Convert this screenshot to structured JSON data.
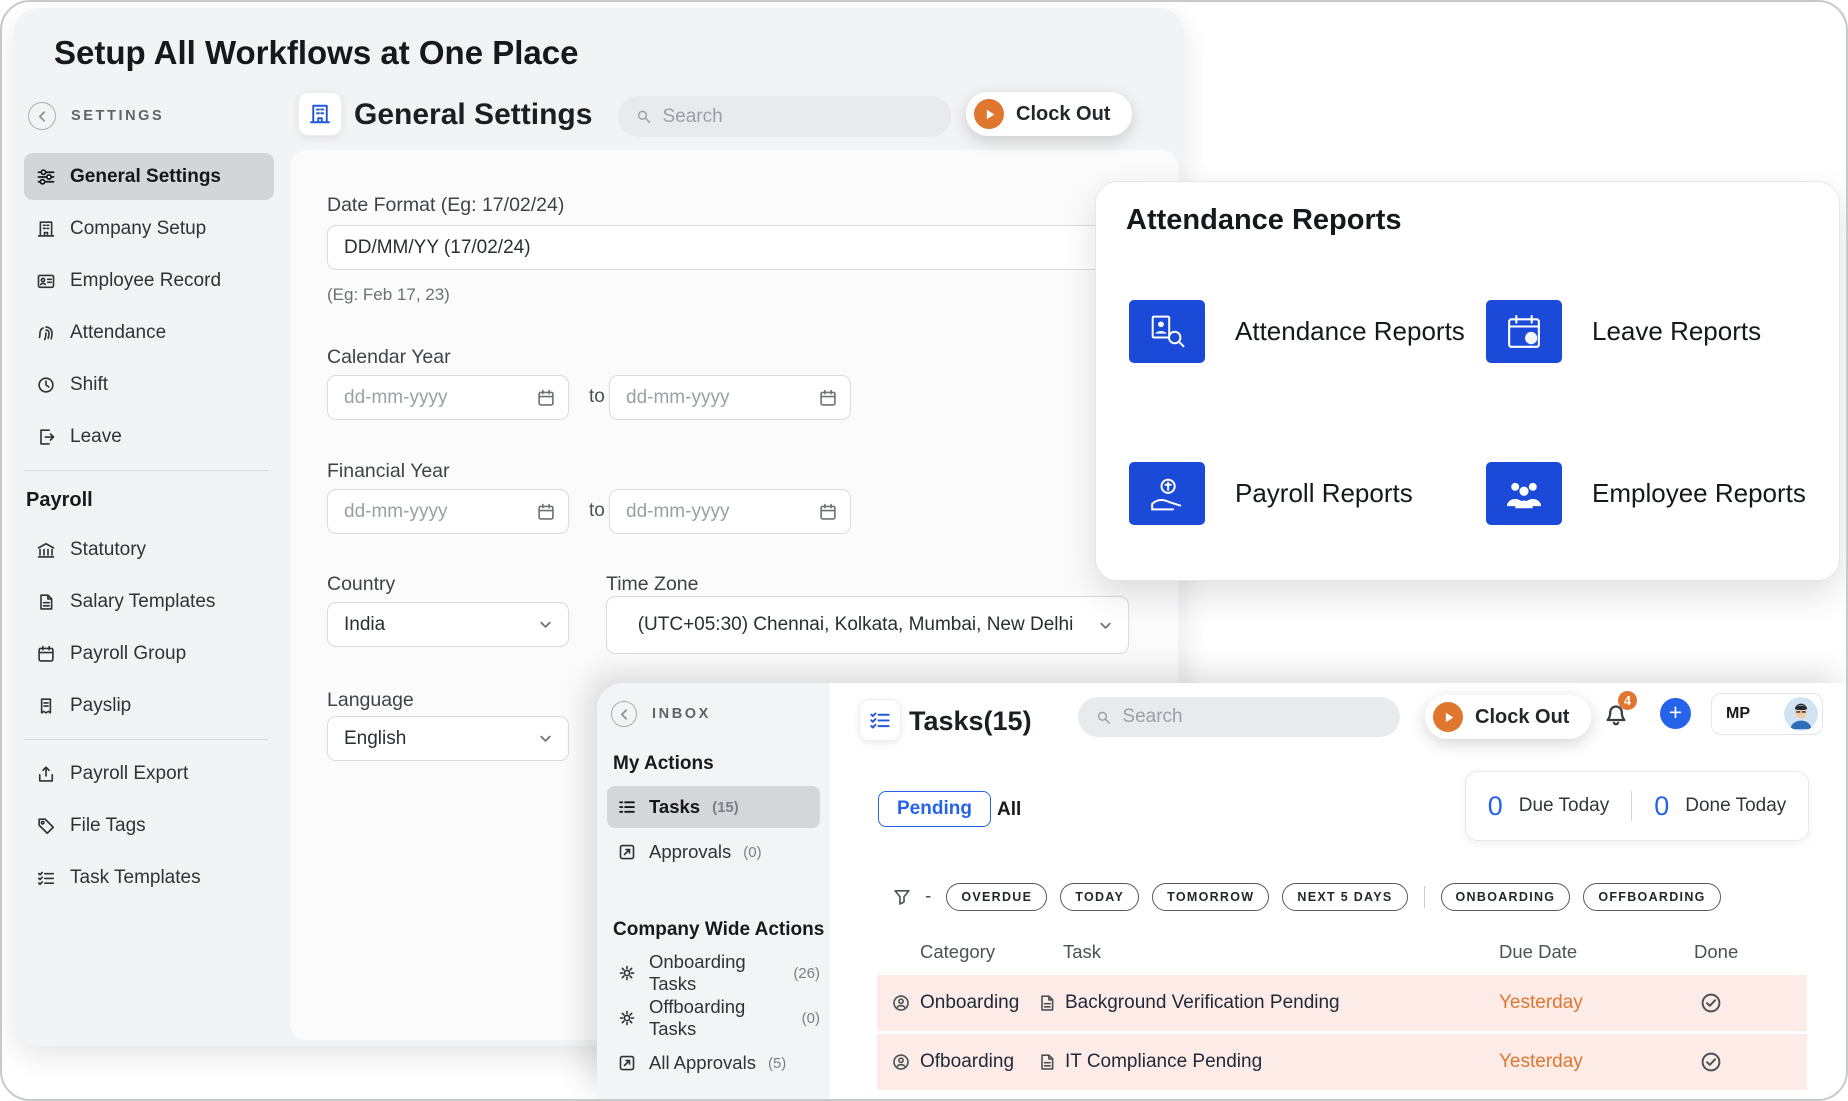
{
  "colors": {
    "accent_blue": "#2563eb",
    "icon_blue": "#1b49d8",
    "orange": "#e0772e",
    "row_pink": "#fcebe7"
  },
  "hero": {
    "title": "Setup All Workflows at One Place"
  },
  "settings": {
    "sidebar": {
      "header": "SETTINGS",
      "items": [
        {
          "label": "General Settings"
        },
        {
          "label": "Company Setup"
        },
        {
          "label": "Employee Record"
        },
        {
          "label": "Attendance"
        },
        {
          "label": "Shift"
        },
        {
          "label": "Leave"
        }
      ],
      "payroll_header": "Payroll",
      "payroll_items": [
        {
          "label": "Statutory"
        },
        {
          "label": "Salary Templates"
        },
        {
          "label": "Payroll Group"
        },
        {
          "label": "Payslip"
        }
      ],
      "bottom_items": [
        {
          "label": "Payroll Export"
        },
        {
          "label": "File Tags"
        },
        {
          "label": "Task Templates"
        }
      ]
    },
    "header": {
      "title": "General Settings",
      "search_placeholder": "Search",
      "clock_out_label": "Clock Out"
    },
    "form": {
      "date_format_label": "Date Format (Eg: 17/02/24)",
      "date_format_value": "DD/MM/YY (17/02/24)",
      "date_format_hint": "(Eg: Feb 17, 23)",
      "calendar_year_label": "Calendar Year",
      "financial_year_label": "Financial Year",
      "date_placeholder": "dd-mm-yyyy",
      "range_to": "to",
      "country_label": "Country",
      "country_value": "India",
      "timezone_label": "Time Zone",
      "timezone_value": "(UTC+05:30) Chennai, Kolkata, Mumbai, New Delhi",
      "language_label": "Language",
      "language_value": "English"
    }
  },
  "reports": {
    "title": "Attendance Reports",
    "items": [
      {
        "label": "Attendance Reports"
      },
      {
        "label": "Leave Reports"
      },
      {
        "label": "Payroll Reports"
      },
      {
        "label": "Employee Reports"
      }
    ]
  },
  "tasks": {
    "sidebar": {
      "header": "INBOX",
      "my_actions_header": "My Actions",
      "my_actions": [
        {
          "label": "Tasks",
          "count": "(15)"
        },
        {
          "label": "Approvals",
          "count": "(0)"
        }
      ],
      "company_header": "Company Wide Actions",
      "company_actions": [
        {
          "label": "Onboarding Tasks",
          "count": "(26)"
        },
        {
          "label": "Offboarding Tasks",
          "count": "(0)"
        },
        {
          "label": "All Approvals",
          "count": "(5)"
        }
      ]
    },
    "header": {
      "title": "Tasks(15)",
      "search_placeholder": "Search",
      "clock_out_label": "Clock Out",
      "notification_count": "4",
      "avatar_initials": "MP"
    },
    "toolbar": {
      "tab_pending": "Pending",
      "tab_all": "All",
      "due_today_value": "0",
      "due_today_label": "Due Today",
      "done_today_value": "0",
      "done_today_label": "Done Today"
    },
    "filters": {
      "date_chips": [
        "OVERDUE",
        "TODAY",
        "TOMORROW",
        "NEXT 5 DAYS"
      ],
      "type_chips": [
        "ONBOARDING",
        "OFFBOARDING"
      ]
    },
    "table": {
      "columns": [
        "Category",
        "Task",
        "Due Date",
        "Done"
      ],
      "rows": [
        {
          "category": "Onboarding",
          "task": "Background Verification Pending",
          "due": "Yesterday"
        },
        {
          "category": "Ofboarding",
          "task": "IT Compliance Pending",
          "due": "Yesterday"
        }
      ]
    }
  }
}
